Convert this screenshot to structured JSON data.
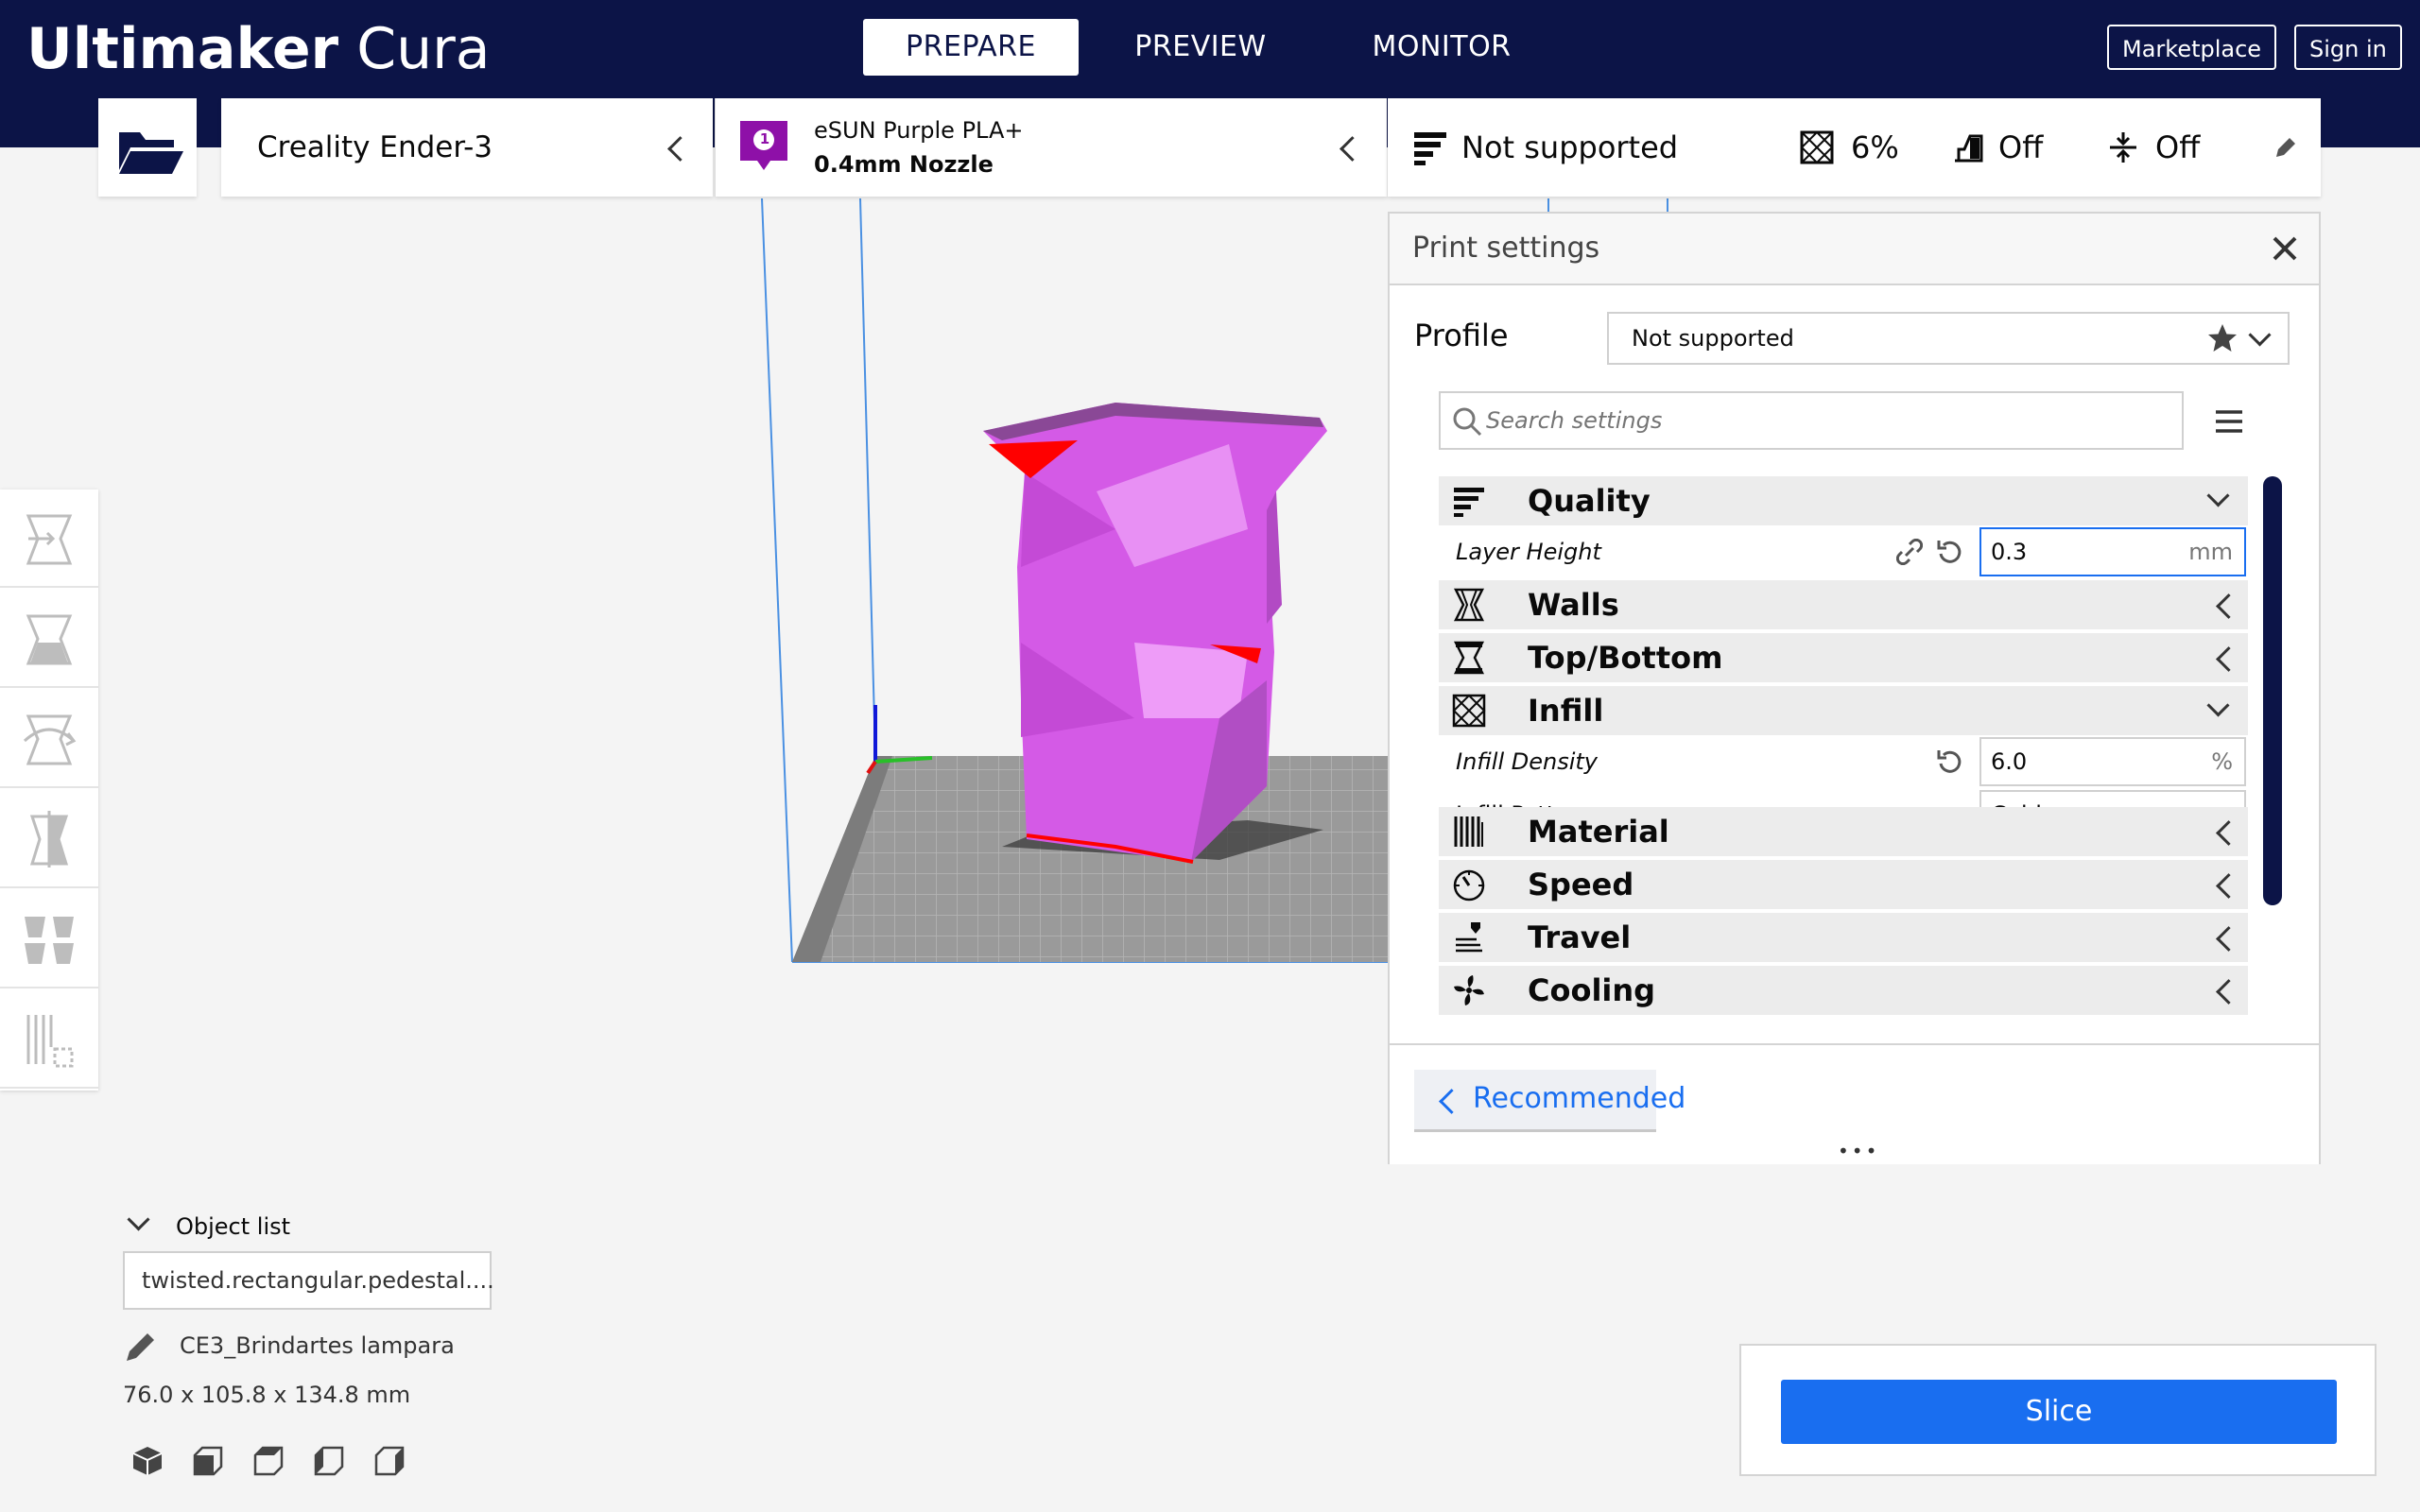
{
  "app": {
    "name_bold": "Ultimaker",
    "name_light": "Cura"
  },
  "stages": [
    "PREPARE",
    "PREVIEW",
    "MONITOR"
  ],
  "header_buttons": {
    "marketplace": "Marketplace",
    "sign_in": "Sign in"
  },
  "printer": {
    "name": "Creality Ender-3"
  },
  "material": {
    "extruder_number": "1",
    "name": "eSUN Purple PLA+",
    "nozzle": "0.4mm Nozzle",
    "badge_color": "#8e10a8"
  },
  "settings_summary": {
    "profile": "Not supported",
    "infill": "6%",
    "support": "Off",
    "adhesion": "Off"
  },
  "print_settings": {
    "title": "Print settings",
    "profile_label": "Profile",
    "profile_value": "Not supported",
    "search_placeholder": "Search settings",
    "categories": {
      "quality": "Quality",
      "walls": "Walls",
      "top_bottom": "Top/Bottom",
      "infill": "Infill",
      "material": "Material",
      "speed": "Speed",
      "travel": "Travel",
      "cooling": "Cooling"
    },
    "layer_height": {
      "label": "Layer Height",
      "value": "0.3",
      "unit": "mm"
    },
    "infill_density": {
      "label": "Infill Density",
      "value": "6.0",
      "unit": "%"
    },
    "infill_pattern": {
      "label": "Infill Pattern",
      "value": "Cubic"
    },
    "recommended_button": "Recommended"
  },
  "object_list": {
    "title": "Object list",
    "selected_object": "twisted.rectangular.pedestal....",
    "job_name": "CE3_Brindartes lampara",
    "dimensions": "76.0 x 105.8 x 134.8 mm"
  },
  "slice_button": "Slice",
  "colors": {
    "header": "#0c1447",
    "accent_blue": "#196ef0",
    "model_magenta": "#d45ae6",
    "overhang_red": "#ff0000"
  }
}
